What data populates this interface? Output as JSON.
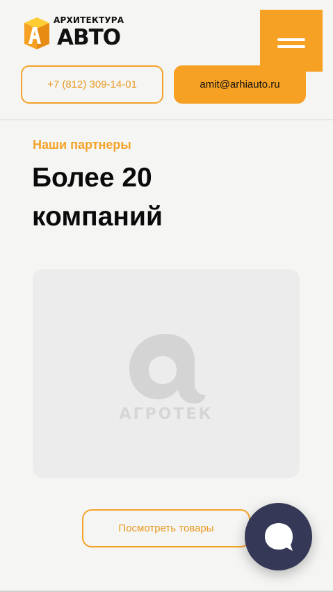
{
  "header": {
    "logo": {
      "line1": "АРХИТЕКТУРА",
      "line2": "АВТО",
      "icon": "logo-cube-icon"
    },
    "menu_icon": "hamburger-menu-icon",
    "phone": "+7 (812) 309-14-01",
    "email": "amit@arhiauto.ru"
  },
  "partners": {
    "eyebrow": "Наши партнеры",
    "title": "Более 20 компаний",
    "card": {
      "name": "АГРОТЕК",
      "logo_icon": "agrotek-logo-icon"
    },
    "button_label": "Посмотреть товары"
  },
  "chat": {
    "icon": "chat-bubble-icon"
  },
  "colors": {
    "accent": "#f6a123",
    "accent_text": "#e99a22",
    "background": "#f5f5f3",
    "card": "#ececec",
    "chat": "#353856",
    "text": "#0a0a0a"
  }
}
